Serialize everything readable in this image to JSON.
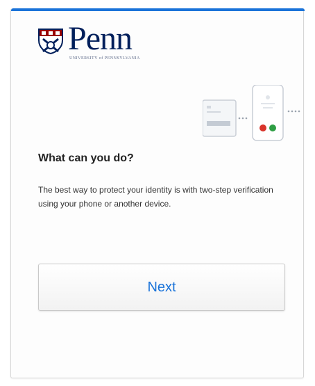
{
  "brand": {
    "wordmark": "Penn",
    "subtitle": "UNIVERSITY of PENNSYLVANIA",
    "color": "#011f5b"
  },
  "accent_color": "#1a73d9",
  "illustration": {
    "description_icon": "phone-verification-icon",
    "dots_colors": [
      "#d9342b",
      "#2e9e44"
    ]
  },
  "content": {
    "heading": "What can you do?",
    "body": "The best way to protect your identity is with two-step verification using your phone or another device."
  },
  "actions": {
    "next_label": "Next"
  }
}
